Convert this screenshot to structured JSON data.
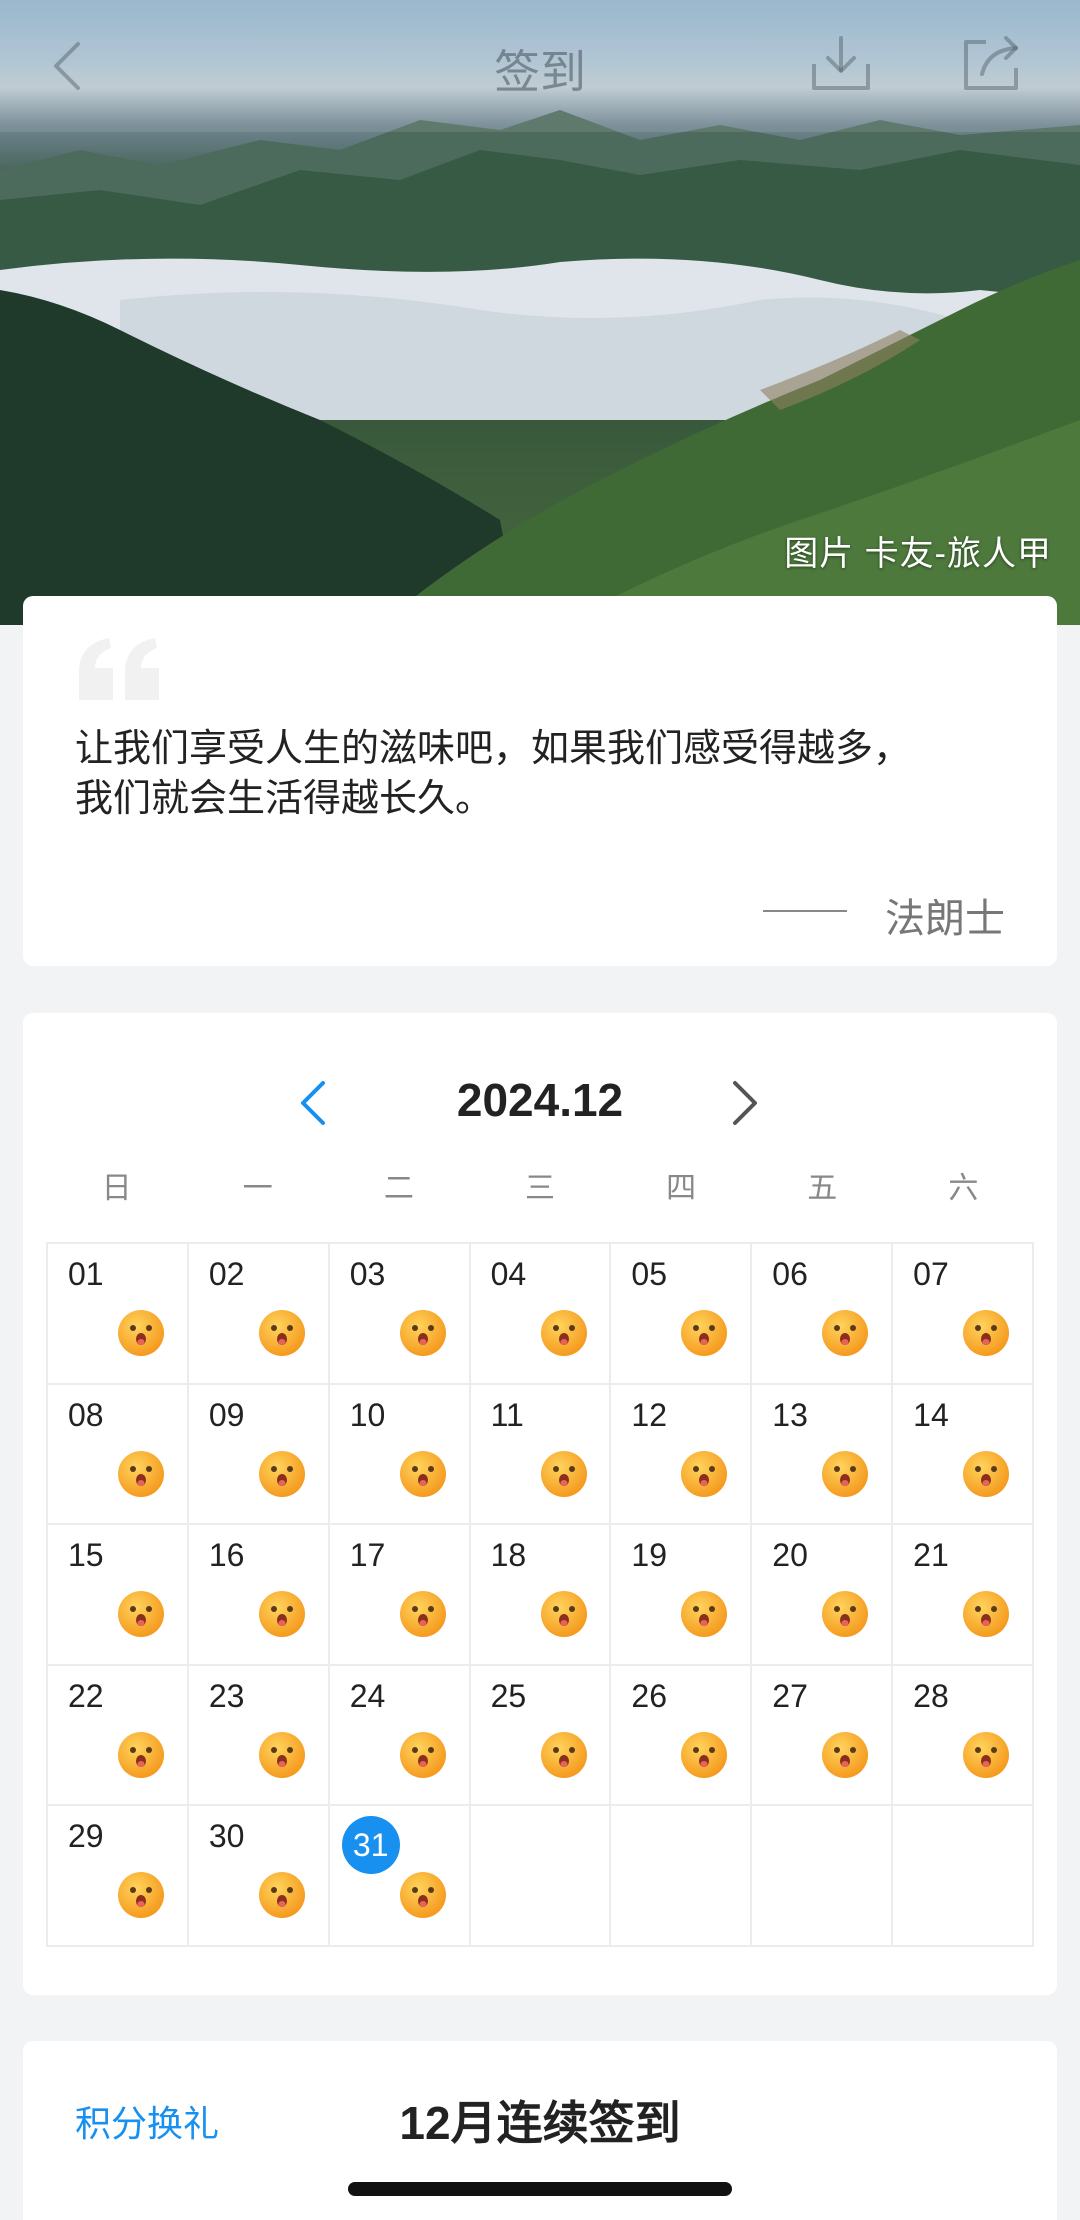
{
  "header": {
    "title": "签到",
    "icons": [
      "chevron-left-icon",
      "download-icon",
      "share-icon"
    ]
  },
  "hero": {
    "photo_credit": "图片 卡友-旅人甲"
  },
  "quote": {
    "text_line1": "让我们享受人生的滋味吧，如果我们感受得越多，",
    "text_line2": "我们就会生活得越长久。",
    "author": "法朗士"
  },
  "calendar": {
    "month_label": "2024.12",
    "weekdays": [
      "日",
      "一",
      "二",
      "三",
      "四",
      "五",
      "六"
    ],
    "days": [
      "01",
      "02",
      "03",
      "04",
      "05",
      "06",
      "07",
      "08",
      "09",
      "10",
      "11",
      "12",
      "13",
      "14",
      "15",
      "16",
      "17",
      "18",
      "19",
      "20",
      "21",
      "22",
      "23",
      "24",
      "25",
      "26",
      "27",
      "28",
      "29",
      "30",
      "31"
    ],
    "today": "31",
    "checked_in_icon": "smiley-face-icon",
    "colors": {
      "accent": "#1890f0",
      "emoji": "#f6a623"
    }
  },
  "streak": {
    "redeem_label": "积分换礼",
    "title": "12月连续签到"
  }
}
